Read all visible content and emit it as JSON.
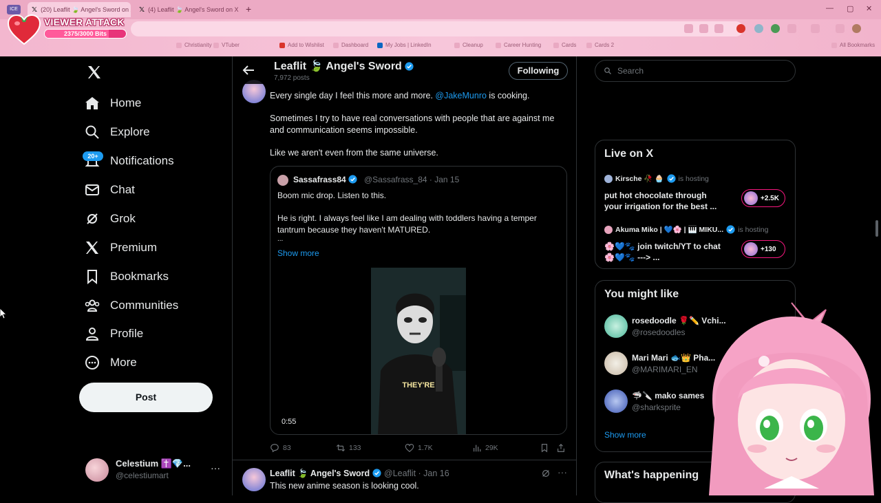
{
  "browser": {
    "tabs": [
      {
        "label": "(20) Leaflit 🍃 Angel's Sword on X"
      },
      {
        "label": "(4) Leaflit 🍃 Angel's Sword on X"
      }
    ],
    "ice_badge": "ICE",
    "bookmarks": [
      "Christianity",
      "VTuber",
      "Add to Wishlist",
      "Dashboard",
      "My Jobs | LinkedIn",
      "Cleanup",
      "Career Hunting",
      "Cards",
      "Cards 2",
      "All Bookmarks"
    ]
  },
  "overlay": {
    "title": "VIEWER ATTACK",
    "bits": "2375/3000 Bits",
    "bits_fraction": 0.79
  },
  "nav": {
    "items": [
      {
        "label": "Home",
        "icon": "home-icon"
      },
      {
        "label": "Explore",
        "icon": "search-icon"
      },
      {
        "label": "Notifications",
        "icon": "bell-icon"
      },
      {
        "label": "Chat",
        "icon": "mail-icon"
      },
      {
        "label": "Grok",
        "icon": "grok-icon"
      },
      {
        "label": "Premium",
        "icon": "x-premium-icon"
      },
      {
        "label": "Bookmarks",
        "icon": "bookmark-icon"
      },
      {
        "label": "Communities",
        "icon": "communities-icon"
      },
      {
        "label": "Profile",
        "icon": "profile-icon"
      },
      {
        "label": "More",
        "icon": "more-icon"
      }
    ],
    "notification_badge": "20+",
    "post_label": "Post",
    "account": {
      "name": "Celestium ✝️💎...",
      "handle": "@celestiumart"
    }
  },
  "header": {
    "name": "Leaflit 🍃 Angel's Sword",
    "posts": "7,972 posts",
    "following_label": "Following"
  },
  "tweet": {
    "line1_prefix": "Every single day I feel this more and more.",
    "mention": "@JakeMunro",
    "line1_suffix": "is cooking.",
    "line2": "Sometimes I try to have real conversations with people that are against me",
    "line3": "and communication seems impossible.",
    "line4": "Like we aren't even from the same universe.",
    "quote": {
      "name": "Sassafrass84",
      "handle_date": "@Sassafrass_84 · Jan 15",
      "text1": "Boom mic drop.  Listen to this.",
      "text2": "He is right. I always feel like I am dealing with toddlers having a temper",
      "text3": "tantrum because they haven't MATURED.",
      "ellipsis": "...",
      "show_more": "Show more",
      "video_caption": "THEY'RE",
      "duration": "0:55"
    },
    "actions": {
      "replies": "83",
      "reposts": "133",
      "likes": "1.7K",
      "views": "29K"
    }
  },
  "tweet2": {
    "name": "Leaflit 🍃 Angel's Sword",
    "handle_date": "@Leaflit · Jan 16",
    "text": "This new anime season is looking cool."
  },
  "right": {
    "search_placeholder": "Search",
    "live": {
      "title": "Live on X",
      "items": [
        {
          "host": "Kirsche 🥀 🧁",
          "status": "is hosting",
          "title1": "put hot chocolate through",
          "title2": "your irrigation for the best ...",
          "count": "+2.5K"
        },
        {
          "host": "Akuma Miko | 💙🌸 | 🎹 MIKU...",
          "status": "is hosting",
          "title1": "🌸💙🐾 join twitch/YT to chat",
          "title2": "🌸💙🐾 ---> ...",
          "count": "+130"
        }
      ]
    },
    "suggest": {
      "title": "You might like",
      "items": [
        {
          "name": "rosedoodle 🌹✏️ Vchi...",
          "handle": "@rosedoodles"
        },
        {
          "name": "Mari Mari 🐟👑 Pha...",
          "handle": "@MARIMARI_EN"
        },
        {
          "name": "🦈🔪 mako sames",
          "handle": "@sharksprite"
        }
      ],
      "show_more": "Show more"
    },
    "happening_title": "What's happening"
  },
  "colors": {
    "accent": "#1d9bf0",
    "background": "#000000",
    "border": "#2f3336",
    "browser_pink": "#f3b7cf"
  }
}
